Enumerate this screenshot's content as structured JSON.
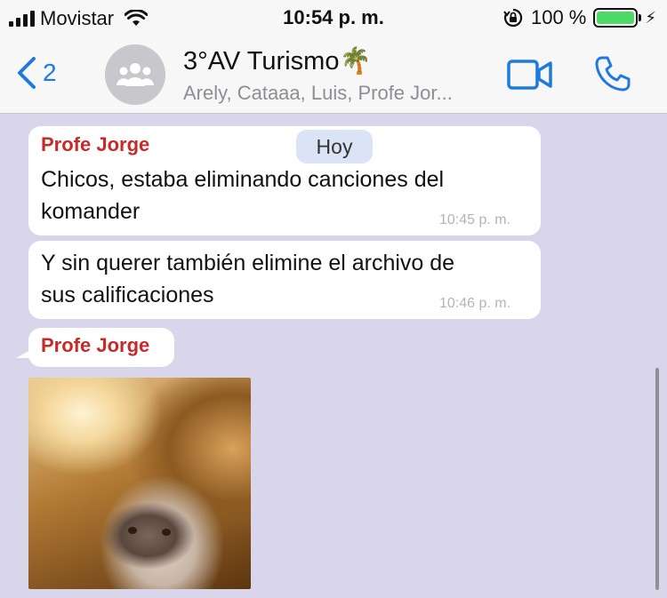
{
  "status_bar": {
    "carrier": "Movistar",
    "time": "10:54 p. m.",
    "battery_percent": "100 %",
    "battery_level": 1.0
  },
  "header": {
    "back_count": "2",
    "title": "3°AV Turismo🌴",
    "subtitle": "Arely, Cataaa, Luis, Profe Jor...",
    "icons": [
      "back-chevron-icon",
      "group-avatar-icon",
      "video-call-icon",
      "phone-call-icon"
    ]
  },
  "chat": {
    "date_separator": "Hoy",
    "messages": [
      {
        "sender": "Profe Jorge",
        "lines": [
          "Chicos, estaba eliminando canciones del",
          "komander"
        ],
        "time": "10:45 p. m."
      },
      {
        "lines": [
          "Y sin querer también elimine el archivo de",
          "sus calificaciones"
        ],
        "time": "10:46 p. m."
      },
      {
        "sender": "Profe Jorge",
        "media": "hamster-photo"
      }
    ]
  },
  "colors": {
    "accent_blue": "#1f7ae0",
    "sender_red": "#c82a2a",
    "chat_background": "#d9d6ec",
    "battery_green": "#4cd964"
  }
}
